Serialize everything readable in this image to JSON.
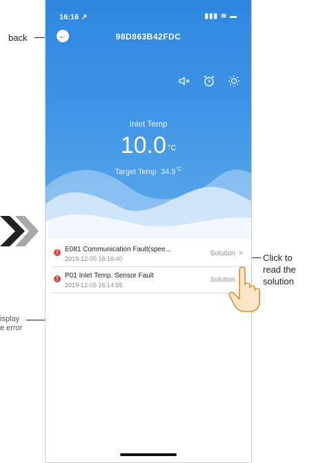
{
  "status_bar": {
    "time": "16:16 ↗",
    "indicators": "▮▮▮ ≋ ▬"
  },
  "header": {
    "device_id": "98D863B42FDC",
    "back_glyph": "←"
  },
  "toolbar": {
    "mute_icon": "speaker-mute",
    "alarm_icon": "alarm-clock",
    "brightness_icon": "sun"
  },
  "temperature": {
    "inlet_label": "Inlet Temp",
    "inlet_value": "10.0",
    "inlet_unit": "°C",
    "target_label": "Target Temp",
    "target_value": "34.9",
    "target_unit": "°C"
  },
  "faults": [
    {
      "name": "E081 Communication Fault(spee...",
      "date": "2019-12-05 16:16:40",
      "action": "Solution",
      "chevron": ">"
    },
    {
      "name": "P01 Inlet Temp. Sensor Fault",
      "date": "2019-12-05 16:14:55",
      "action": "Solution",
      "chevron": ">"
    }
  ],
  "annotations": {
    "back": "back",
    "click_line1": "Click to",
    "click_line2": "read the",
    "click_line3": "solution",
    "display_line1": "isplay",
    "display_line2": "e error"
  },
  "colors": {
    "accent": "#2f86e0",
    "error": "#e0443e",
    "chevron_arrow": "#9e9e9e"
  }
}
